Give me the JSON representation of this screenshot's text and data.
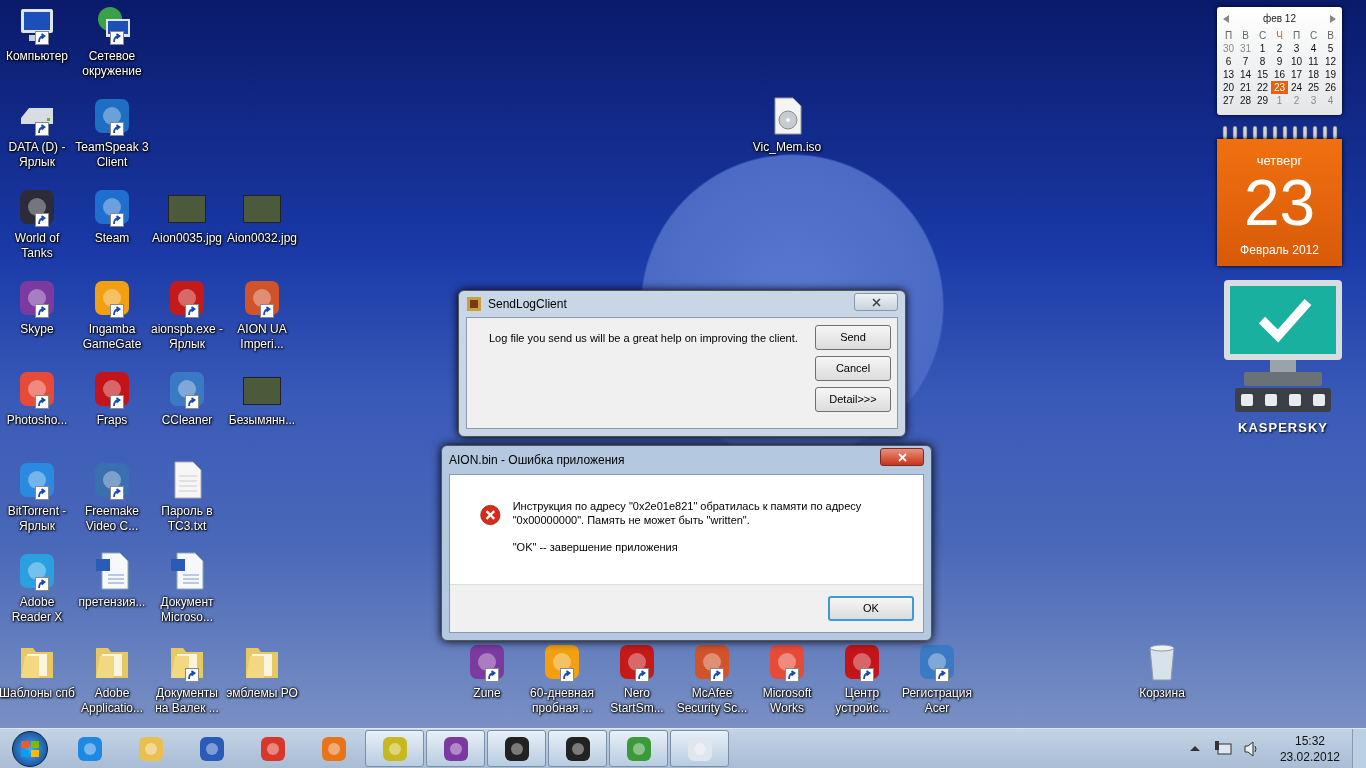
{
  "desktop_icons": [
    {
      "label": "Компьютер",
      "kind": "computer",
      "shortcut": true
    },
    {
      "label": "Сетевое окружение",
      "kind": "network",
      "shortcut": true
    },
    {
      "label": "DATA (D) - Ярлык",
      "kind": "drive",
      "shortcut": true
    },
    {
      "label": "TeamSpeak 3 Client",
      "kind": "app",
      "shortcut": true
    },
    {
      "label": "Vic_Mem.iso",
      "kind": "disc-image",
      "shortcut": false
    },
    {
      "label": "World of Tanks",
      "kind": "app",
      "shortcut": true
    },
    {
      "label": "Steam",
      "kind": "app",
      "shortcut": true
    },
    {
      "label": "Aion0035.jpg",
      "kind": "image",
      "shortcut": false
    },
    {
      "label": "Aion0032.jpg",
      "kind": "image",
      "shortcut": false
    },
    {
      "label": "Skype",
      "kind": "app",
      "shortcut": true
    },
    {
      "label": "Ingamba GameGate",
      "kind": "app",
      "shortcut": true
    },
    {
      "label": "aionspb.exe - Ярлык",
      "kind": "app",
      "shortcut": true
    },
    {
      "label": "AION UA Imperi...",
      "kind": "app",
      "shortcut": true
    },
    {
      "label": "Photosho...",
      "kind": "app",
      "shortcut": true
    },
    {
      "label": "Fraps",
      "kind": "app",
      "shortcut": true
    },
    {
      "label": "CCleaner",
      "kind": "app",
      "shortcut": true
    },
    {
      "label": "Безымянн...",
      "kind": "image",
      "shortcut": false
    },
    {
      "label": "BitTorrent - Ярлык",
      "kind": "app",
      "shortcut": true
    },
    {
      "label": "Freemake Video C...",
      "kind": "app",
      "shortcut": true
    },
    {
      "label": "Пароль в TC3.txt",
      "kind": "text-file",
      "shortcut": false
    },
    {
      "label": "Adobe Reader X",
      "kind": "app",
      "shortcut": true
    },
    {
      "label": "претензия...",
      "kind": "word-doc",
      "shortcut": false
    },
    {
      "label": "Документ Microso...",
      "kind": "word-doc",
      "shortcut": false
    },
    {
      "label": "Шаблоны спб",
      "kind": "folder",
      "shortcut": false
    },
    {
      "label": "Adobe Applicatio...",
      "kind": "folder",
      "shortcut": false
    },
    {
      "label": "Документы на Валек ...",
      "kind": "folder",
      "shortcut": true
    },
    {
      "label": "эмблемы РО",
      "kind": "folder",
      "shortcut": false
    },
    {
      "label": "Zune",
      "kind": "app",
      "shortcut": true
    },
    {
      "label": "60-дневная пробная ...",
      "kind": "app",
      "shortcut": true
    },
    {
      "label": "Nero StartSm...",
      "kind": "app",
      "shortcut": true
    },
    {
      "label": "McAfee Security Sc...",
      "kind": "app",
      "shortcut": true
    },
    {
      "label": "Microsoft Works",
      "kind": "app",
      "shortcut": true
    },
    {
      "label": "Центр устройс...",
      "kind": "app",
      "shortcut": true
    },
    {
      "label": "Регистрация Acer",
      "kind": "app",
      "shortcut": true
    },
    {
      "label": "Корзина",
      "kind": "recycle-bin",
      "shortcut": false
    }
  ],
  "calendar_gadget": {
    "month": "фев 12",
    "weekdays": [
      {
        "label": "П",
        "selected": false
      },
      {
        "label": "В",
        "selected": false
      },
      {
        "label": "С",
        "selected": false
      },
      {
        "label": "Ч",
        "selected": true
      },
      {
        "label": "П",
        "selected": false
      },
      {
        "label": "С",
        "selected": false
      },
      {
        "label": "В",
        "selected": false
      }
    ],
    "weeks": [
      [
        {
          "day": "30",
          "other_month": true,
          "selected": false
        },
        {
          "day": "31",
          "other_month": true,
          "selected": false
        },
        {
          "day": "1",
          "other_month": false,
          "selected": false
        },
        {
          "day": "2",
          "other_month": false,
          "selected": false
        },
        {
          "day": "3",
          "other_month": false,
          "selected": false
        },
        {
          "day": "4",
          "other_month": false,
          "selected": false
        },
        {
          "day": "5",
          "other_month": false,
          "selected": false
        }
      ],
      [
        {
          "day": "6",
          "other_month": false,
          "selected": false
        },
        {
          "day": "7",
          "other_month": false,
          "selected": false
        },
        {
          "day": "8",
          "other_month": false,
          "selected": false
        },
        {
          "day": "9",
          "other_month": false,
          "selected": false
        },
        {
          "day": "10",
          "other_month": false,
          "selected": false
        },
        {
          "day": "11",
          "other_month": false,
          "selected": false
        },
        {
          "day": "12",
          "other_month": false,
          "selected": false
        }
      ],
      [
        {
          "day": "13",
          "other_month": false,
          "selected": false
        },
        {
          "day": "14",
          "other_month": false,
          "selected": false
        },
        {
          "day": "15",
          "other_month": false,
          "selected": false
        },
        {
          "day": "16",
          "other_month": false,
          "selected": false
        },
        {
          "day": "17",
          "other_month": false,
          "selected": false
        },
        {
          "day": "18",
          "other_month": false,
          "selected": false
        },
        {
          "day": "19",
          "other_month": false,
          "selected": false
        }
      ],
      [
        {
          "day": "20",
          "other_month": false,
          "selected": false
        },
        {
          "day": "21",
          "other_month": false,
          "selected": false
        },
        {
          "day": "22",
          "other_month": false,
          "selected": false
        },
        {
          "day": "23",
          "other_month": false,
          "selected": true
        },
        {
          "day": "24",
          "other_month": false,
          "selected": false
        },
        {
          "day": "25",
          "other_month": false,
          "selected": false
        },
        {
          "day": "26",
          "other_month": false,
          "selected": false
        }
      ],
      [
        {
          "day": "27",
          "other_month": false,
          "selected": false
        },
        {
          "day": "28",
          "other_month": false,
          "selected": false
        },
        {
          "day": "29",
          "other_month": false,
          "selected": false
        },
        {
          "day": "1",
          "other_month": true,
          "selected": false
        },
        {
          "day": "2",
          "other_month": true,
          "selected": false
        },
        {
          "day": "3",
          "other_month": true,
          "selected": false
        },
        {
          "day": "4",
          "other_month": true,
          "selected": false
        }
      ]
    ],
    "weekday": "четверг",
    "day": "23",
    "month_year": "Февраль 2012"
  },
  "security_gadget": {
    "brand": "KASPERSKY"
  },
  "sendlog_window": {
    "title": "SendLogClient",
    "message": "Log file you send us will be a great help on improving the client.",
    "buttons": [
      "Send",
      "Cancel",
      "Detail>>>"
    ]
  },
  "error_dialog": {
    "title": "AION.bin - Ошибка приложения",
    "message": "Инструкция по адресу \"0x2e01e821\" обратилась к памяти по адресу \"0x00000000\". Память не может быть \"written\".",
    "note": "\"OK\" -- завершение приложения",
    "button": "OK"
  },
  "taskbar": {
    "items": [
      {
        "running": false
      },
      {
        "running": false
      },
      {
        "running": false
      },
      {
        "running": false
      },
      {
        "running": false
      },
      {
        "running": true
      },
      {
        "running": true
      },
      {
        "running": true
      },
      {
        "running": true
      },
      {
        "running": true
      },
      {
        "running": true
      }
    ],
    "clock": {
      "time": "15:32",
      "date": "23.02.2012"
    }
  }
}
